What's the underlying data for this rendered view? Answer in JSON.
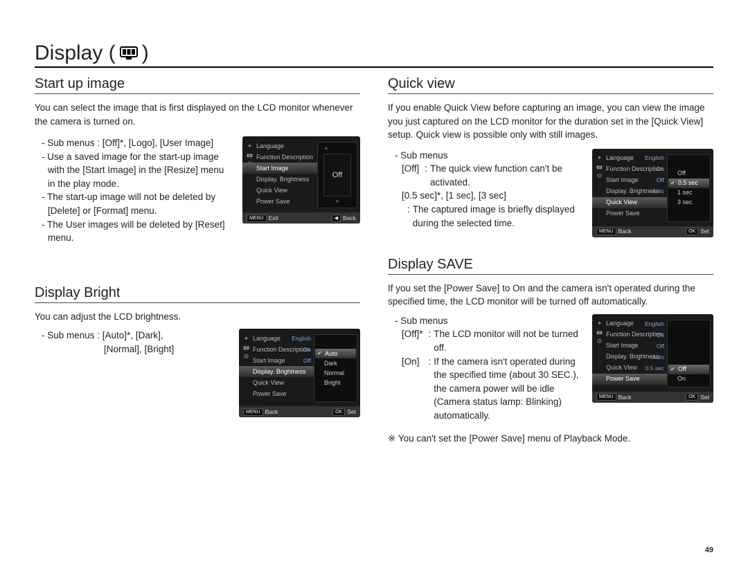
{
  "page_number": "49",
  "title_prefix": "Display (",
  "title_suffix": " )",
  "sections": {
    "startup": {
      "title": "Start up image",
      "intro": "You can select the image that is first displayed on the LCD monitor whenever the camera is turned on.",
      "b1": "- Sub menus : [Off]*, [Logo], [User Image]",
      "b2": "- Use a saved image for the start-up image with the [Start Image] in the [Resize] menu in the play mode.",
      "b3": "- The start-up image will not be deleted by [Delete] or [Format] menu.",
      "b4": "- The User images will be deleted by [Reset] menu.",
      "lcd": {
        "rows": [
          "Language",
          "Function Description",
          "Start Image",
          "Display. Brightness",
          "Quick View",
          "Power Save"
        ],
        "selected_index": 2,
        "panel_center": "Off",
        "footer_left_key": "MENU",
        "footer_left": "Exit",
        "footer_right_key": "◀",
        "footer_right": "Back"
      }
    },
    "bright": {
      "title": "Display Bright",
      "intro": "You can adjust the LCD brightness.",
      "b1": "- Sub menus : [Auto]*, [Dark],",
      "b1b": "                        [Normal], [Bright]",
      "lcd": {
        "rows": [
          "Language",
          "Function Description",
          "Start Image",
          "Display. Brightness",
          "Quick View",
          "Power Save"
        ],
        "row_values": [
          "English",
          "On",
          "Off",
          "",
          "",
          ""
        ],
        "selected_index": 3,
        "options": [
          "Auto",
          "Dark",
          "Normal",
          "Bright"
        ],
        "options_selected": 0,
        "footer_left_key": "MENU",
        "footer_left": "Back",
        "footer_right_key": "OK",
        "footer_right": "Set"
      }
    },
    "quick": {
      "title": "Quick view",
      "intro": "If you enable Quick View before capturing an image, you can view the image you just captured on the LCD monitor for the duration set in the [Quick View] setup. Quick view is possible only with still images.",
      "sub_label": "- Sub menus",
      "d1_label": "[Off]",
      "d1_val": "The quick view function can't be activated.",
      "d2_label": "[0.5 sec]*, [1 sec], [3 sec]",
      "d2_val": "The captured image is briefly displayed during the selected time.",
      "lcd": {
        "rows": [
          "Language",
          "Function Description",
          "Start Image",
          "Display. Brightness",
          "Quick View",
          "Power Save"
        ],
        "row_values": [
          "English",
          "On",
          "Off",
          "Auto",
          "",
          ""
        ],
        "selected_index": 4,
        "options": [
          "Off",
          "0.5 sec",
          "1 sec",
          "3 sec"
        ],
        "options_selected": 1,
        "footer_left_key": "MENU",
        "footer_left": "Back",
        "footer_right_key": "OK",
        "footer_right": "Set"
      }
    },
    "save": {
      "title": "Display SAVE",
      "intro": "If you set the [Power Save] to On and the camera isn't operated during the specified time, the LCD monitor will be turned off automatically.",
      "sub_label": "- Sub menus",
      "d1_label": "[Off]*",
      "d1_val": "The LCD monitor will not be turned off.",
      "d2_label": "[On]",
      "d2_val": "If the camera isn't operated during the specified time (about 30 SEC.), the camera power will be idle (Camera status lamp: Blinking) automatically.",
      "note": "※ You can't set the [Power Save] menu of Playback Mode.",
      "lcd": {
        "rows": [
          "Language",
          "Function Description",
          "Start Image",
          "Display. Brightness",
          "Quick View",
          "Power Save"
        ],
        "row_values": [
          "English",
          "On",
          "Off",
          "Auto",
          "0.5 sec",
          ""
        ],
        "selected_index": 5,
        "options": [
          "Off",
          "On"
        ],
        "options_selected": 0,
        "footer_left_key": "MENU",
        "footer_left": "Back",
        "footer_right_key": "OK",
        "footer_right": "Set"
      }
    }
  }
}
